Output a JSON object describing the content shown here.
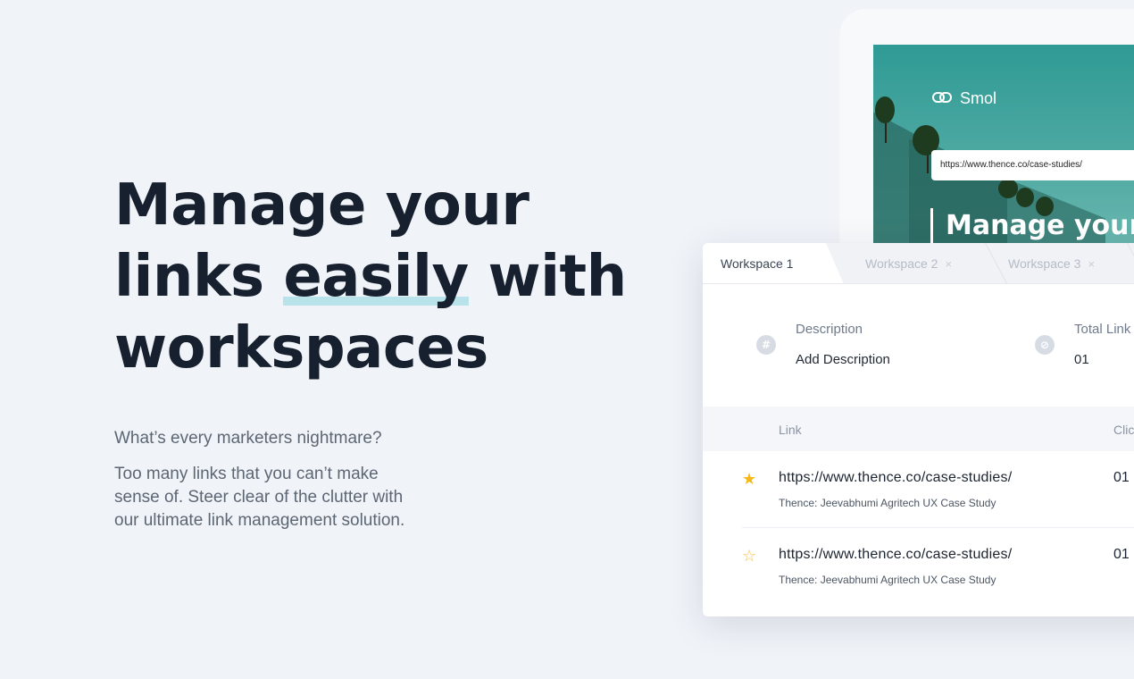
{
  "hero": {
    "title_line1": "Manage your",
    "title_line2_pre": "links ",
    "title_highlight": "easily",
    "title_line2_post": " with",
    "title_line3": "workspaces",
    "subtitle": "What’s every marketers nightmare?",
    "body": "Too many links that you can’t make sense of. Steer clear of the clutter with our ultimate link management solution."
  },
  "preview": {
    "brand": "Smol",
    "brand_icon": "link-icon",
    "url_value": "https://www.thence.co/case-studies/",
    "heading": "Manage your"
  },
  "workspace": {
    "tabs": [
      {
        "label": "Workspace 1",
        "active": true
      },
      {
        "label": "Workspace 2",
        "close": "×"
      },
      {
        "label": "Workspace 3",
        "close": "×"
      }
    ],
    "meta": {
      "description_label": "Description",
      "description_value": "Add Description",
      "description_icon": "hash-icon",
      "total_label": "Total Link",
      "total_value": "01",
      "total_icon": "link-icon"
    },
    "columns": {
      "link": "Link",
      "clicks": "Clic"
    },
    "rows": [
      {
        "starred": true,
        "url": "https://www.thence.co/case-studies/",
        "description": "Thence: Jeevabhumi Agritech UX Case Study",
        "clicks": "01"
      },
      {
        "starred": false,
        "url": "https://www.thence.co/case-studies/",
        "description": "Thence: Jeevabhumi Agritech UX Case Study",
        "clicks": "01"
      }
    ]
  },
  "colors": {
    "background": "#f0f3f8",
    "heading": "#16202f",
    "highlight": "#b9e3ea",
    "preview_teal": "#4faaa3",
    "star": "#f5b818"
  }
}
